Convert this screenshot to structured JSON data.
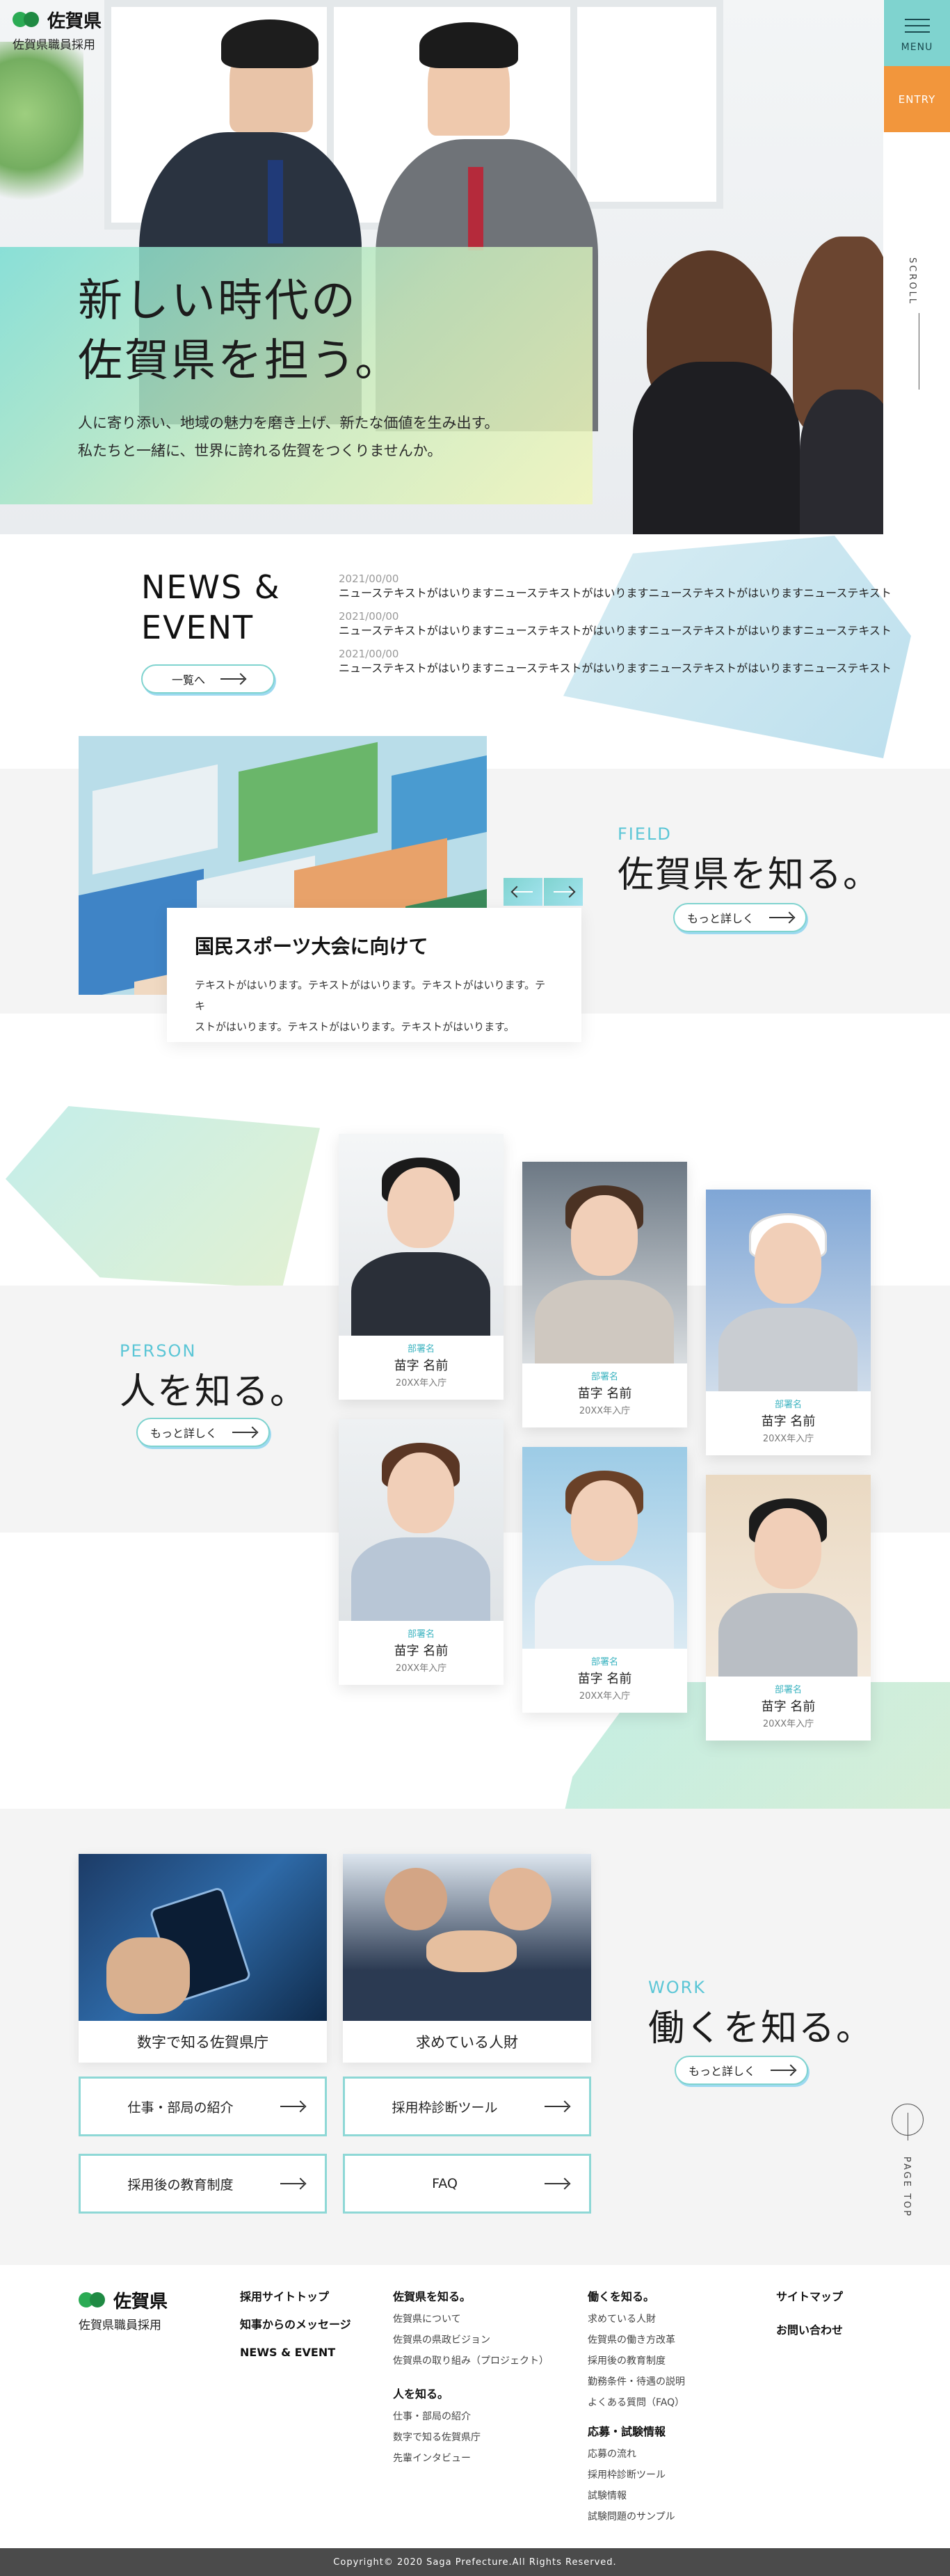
{
  "header": {
    "logo_name": "佐賀県",
    "logo_sub": "佐賀県職員採用",
    "menu_label": "MENU",
    "entry_label": "ENTRY"
  },
  "hero": {
    "title_line1": "新しい時代の",
    "title_line2": "佐賀県を担う。",
    "lead_line1": "人に寄り添い、地域の魅力を磨き上げ、新たな価値を生み出す。",
    "lead_line2": "私たちと一緒に、世界に誇れる佐賀をつくりませんか。",
    "scroll_label": "SCROLL"
  },
  "news": {
    "title_line1": "NEWS &",
    "title_line2": "EVENT",
    "button_label": "一覧へ",
    "items": [
      {
        "date": "2021/00/00",
        "text": "ニューステキストがはいりますニューステキストがはいりますニューステキストがはいりますニューステキスト"
      },
      {
        "date": "2021/00/00",
        "text": "ニューステキストがはいりますニューステキストがはいりますニューステキストがはいりますニューステキスト"
      },
      {
        "date": "2021/00/00",
        "text": "ニューステキストがはいりますニューステキストがはいりますニューステキストがはいりますニューステキスト"
      }
    ]
  },
  "field": {
    "label_en": "FIELD",
    "label_jp": "佐賀県を知る。",
    "button_label": "もっと詳しく",
    "card_title": "国民スポーツ大会に向けて",
    "card_text_line1": "テキストがはいります。テキストがはいります。テキストがはいります。テキ",
    "card_text_line2": "ストがはいります。テキストがはいります。テキストがはいります。"
  },
  "person": {
    "label_en": "PERSON",
    "label_jp": "人を知る。",
    "button_label": "もっと詳しく",
    "cards": [
      {
        "dept": "部署名",
        "name": "苗字 名前",
        "year": "20XX年入庁"
      },
      {
        "dept": "部署名",
        "name": "苗字 名前",
        "year": "20XX年入庁"
      },
      {
        "dept": "部署名",
        "name": "苗字 名前",
        "year": "20XX年入庁"
      },
      {
        "dept": "部署名",
        "name": "苗字 名前",
        "year": "20XX年入庁"
      },
      {
        "dept": "部署名",
        "name": "苗字 名前",
        "year": "20XX年入庁"
      },
      {
        "dept": "部署名",
        "name": "苗字 名前",
        "year": "20XX年入庁"
      }
    ]
  },
  "work": {
    "label_en": "WORK",
    "label_jp": "働くを知る。",
    "button_label": "もっと詳しく",
    "card1_label": "数字で知る佐賀県庁",
    "card2_label": "求めている人財",
    "links": [
      "仕事・部局の紹介",
      "採用枠診断ツール",
      "採用後の教育制度",
      "FAQ"
    ],
    "pagetop_label": "PAGE TOP"
  },
  "footer": {
    "logo_name": "佐賀県",
    "logo_sub": "佐賀県職員採用",
    "col1": [
      "採用サイトトップ",
      "知事からのメッセージ",
      "NEWS & EVENT"
    ],
    "col2_head": "佐賀県を知る。",
    "col2_items": [
      "佐賀県について",
      "佐賀県の県政ビジョン",
      "佐賀県の取り組み（プロジェクト）"
    ],
    "col2b_head": "人を知る。",
    "col2b_items": [
      "仕事・部局の紹介",
      "数字で知る佐賀県庁",
      "先輩インタビュー"
    ],
    "col3_head": "働くを知る。",
    "col3_items": [
      "求めている人財",
      "佐賀県の働き方改革",
      "採用後の教育制度",
      "勤務条件・待遇の説明",
      "よくある質問（FAQ）"
    ],
    "col3b_head": "応募・試験情報",
    "col3b_items": [
      "応募の流れ",
      "採用枠診断ツール",
      "試験情報",
      "試験問題のサンプル"
    ],
    "col4": [
      "サイトマップ",
      "お問い合わせ"
    ],
    "copyright": "Copyright© 2020 Saga Prefecture.All Rights Reserved."
  },
  "colors": {
    "accent_teal": "#7fd3cf",
    "entry_orange": "#f2963c",
    "label_blue": "#5bc6d6",
    "logo_green": "#2bab54"
  }
}
